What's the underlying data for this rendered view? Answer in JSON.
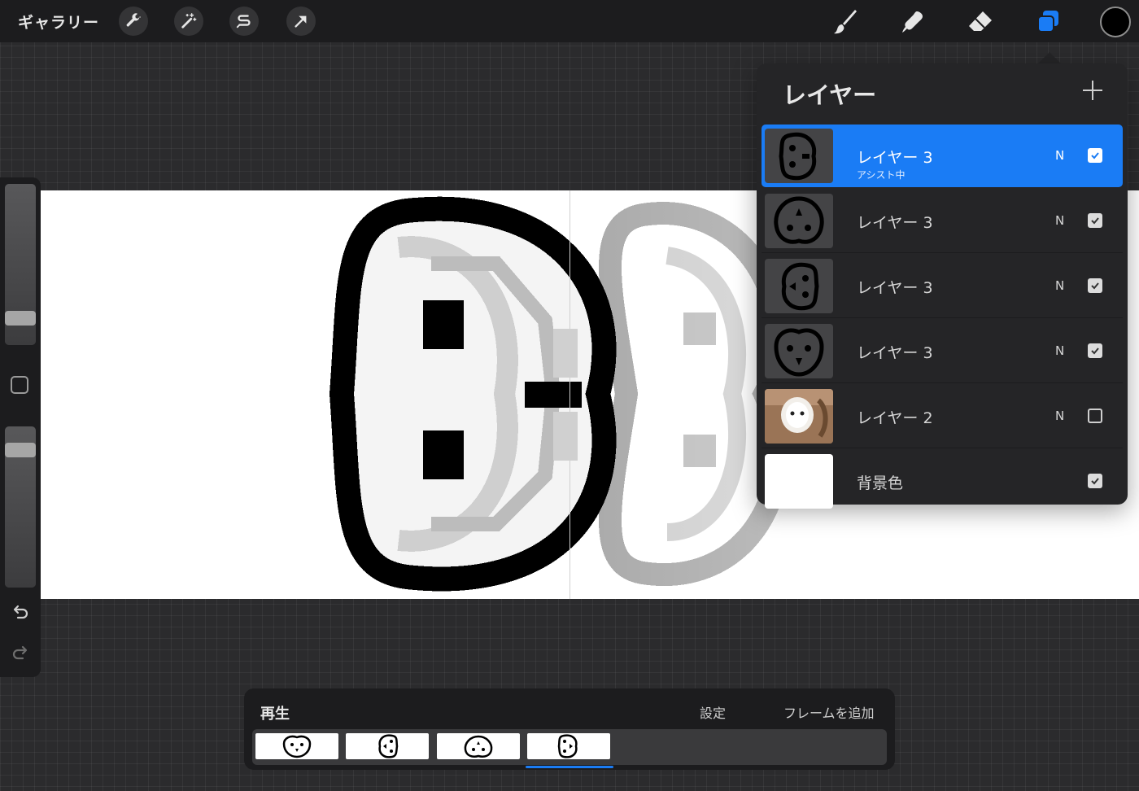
{
  "toolbar": {
    "gallery_label": "ギャラリー",
    "adjust_icons": [
      "wrench-icon",
      "magic-wand-icon",
      "selection-icon",
      "transform-arrow-icon"
    ],
    "tool_icons": [
      "brush-icon",
      "smudge-icon",
      "eraser-icon",
      "layers-icon"
    ],
    "active_tool": "layers-icon",
    "current_color": "#000000",
    "accent_color": "#1a7cf5"
  },
  "sidebar": {
    "icons": [
      "undo-icon",
      "redo-icon"
    ]
  },
  "layers": {
    "title": "レイヤー",
    "items": [
      {
        "name": "レイヤー 3",
        "sub": "アシスト中",
        "blend": "N",
        "visible": true,
        "selected": true,
        "thumb": "face-right"
      },
      {
        "name": "レイヤー 3",
        "sub": "",
        "blend": "N",
        "visible": true,
        "selected": false,
        "thumb": "face-up"
      },
      {
        "name": "レイヤー 3",
        "sub": "",
        "blend": "N",
        "visible": true,
        "selected": false,
        "thumb": "face-left"
      },
      {
        "name": "レイヤー 3",
        "sub": "",
        "blend": "N",
        "visible": true,
        "selected": false,
        "thumb": "face-owl"
      },
      {
        "name": "レイヤー 2",
        "sub": "",
        "blend": "N",
        "visible": false,
        "selected": false,
        "thumb": "photo-owl"
      },
      {
        "name": "背景色",
        "sub": "",
        "blend": "",
        "visible": true,
        "selected": false,
        "thumb": "white"
      }
    ]
  },
  "animation": {
    "play_label": "再生",
    "settings_label": "設定",
    "add_frame_label": "フレームを追加",
    "frames": [
      "face-owl",
      "face-left",
      "face-up",
      "face-right"
    ],
    "current_frame": 4
  }
}
